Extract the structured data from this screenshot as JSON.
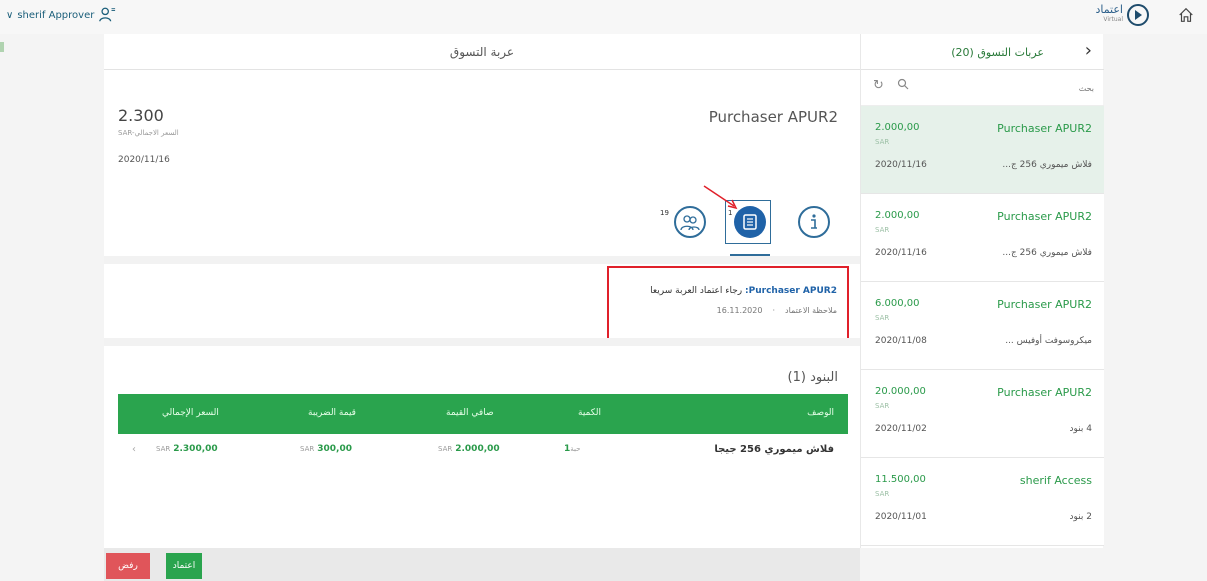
{
  "topbar": {
    "user_label": "sherif Approver",
    "brand_title": "اعتماد",
    "brand_sub": "Virtual"
  },
  "main": {
    "title": "عربة التسوق",
    "total": "2.300",
    "total_label": "SAR-السعر الاجمالي",
    "date": "2020/11/16",
    "purchaser": "Purchaser APUR2",
    "badges": {
      "people": "19",
      "notes": "1"
    },
    "note": {
      "author": "Purchaser APUR2:",
      "text": "رجاء اعتماد العربة سريعا",
      "date": "16.11.2020",
      "label": "ملاحظة الاعتماد"
    },
    "items_title": "البنود (1)",
    "table": {
      "headers": {
        "description": "الوصف",
        "quantity": "الكمية",
        "net_value": "صافي القيمة",
        "tax_value": "قيمة الضريبة",
        "total_price": "السعر الإجمالي"
      },
      "rows": [
        {
          "description": "فلاش ميموري 256 جيجا",
          "quantity": "1",
          "unit": "حبة",
          "net_value": "2.000,00",
          "tax_value": "300,00",
          "total_price": "2.300,00",
          "currency": "SAR"
        }
      ]
    }
  },
  "actions": {
    "reject": "رفض",
    "approve": "اعتماد"
  },
  "rpanel": {
    "title": "عربات التسوق (20)",
    "search_placeholder": "بحث",
    "carts": [
      {
        "amount": "2.000,00",
        "currency": "SAR",
        "date": "2020/11/16",
        "name": "Purchaser APUR2",
        "desc": "فلاش ميموري 256 ج..."
      },
      {
        "amount": "2.000,00",
        "currency": "SAR",
        "date": "2020/11/16",
        "name": "Purchaser APUR2",
        "desc": "فلاش ميموري 256 ج..."
      },
      {
        "amount": "6.000,00",
        "currency": "SAR",
        "date": "2020/11/08",
        "name": "Purchaser APUR2",
        "desc": "ميكروسوفت أوفيس ..."
      },
      {
        "amount": "20.000,00",
        "currency": "SAR",
        "date": "2020/11/02",
        "name": "Purchaser APUR2",
        "desc": "4 بنود"
      },
      {
        "amount": "11.500,00",
        "currency": "SAR",
        "date": "2020/11/01",
        "name": "sherif Access",
        "desc": "2 بنود"
      }
    ]
  },
  "colors": {
    "accent_green": "#2aa44e",
    "accent_blue": "#1f62a8",
    "reject_red": "#e0555a",
    "highlight_red": "#e0202a"
  }
}
